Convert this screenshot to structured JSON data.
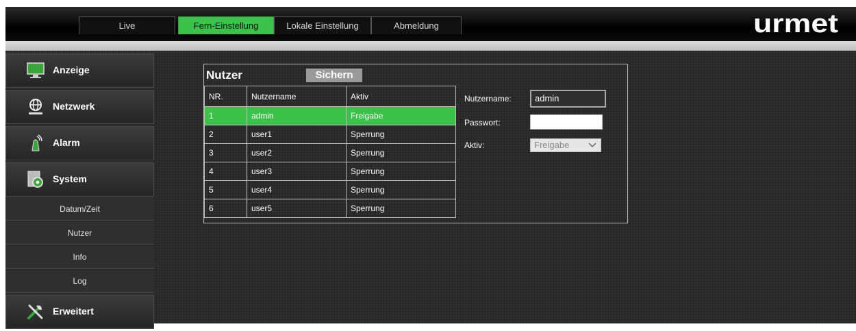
{
  "nav_tabs": [
    {
      "label": "Live",
      "active": false
    },
    {
      "label": "Fern-Einstellung",
      "active": true
    },
    {
      "label": "Lokale Einstellung",
      "active": false
    },
    {
      "label": "Abmeldung",
      "active": false
    }
  ],
  "logo_text": "urmet",
  "sidebar": {
    "items": [
      {
        "label": "Anzeige",
        "icon": "monitor-icon"
      },
      {
        "label": "Netzwerk",
        "icon": "network-globe-icon"
      },
      {
        "label": "Alarm",
        "icon": "alarm-siren-icon"
      },
      {
        "label": "System",
        "icon": "system-gear-icon"
      }
    ],
    "system_subitems": [
      {
        "label": "Datum/Zeit"
      },
      {
        "label": "Nutzer"
      },
      {
        "label": "Info"
      },
      {
        "label": "Log"
      }
    ],
    "advanced": {
      "label": "Erweitert",
      "icon": "tools-icon"
    }
  },
  "panel": {
    "title": "Nutzer",
    "save_label": "Sichern"
  },
  "table": {
    "headers": [
      "NR.",
      "Nutzername",
      "Aktiv"
    ],
    "rows": [
      {
        "nr": "1",
        "name": "admin",
        "status": "Freigabe",
        "selected": true
      },
      {
        "nr": "2",
        "name": "user1",
        "status": "Sperrung",
        "selected": false
      },
      {
        "nr": "3",
        "name": "user2",
        "status": "Sperrung",
        "selected": false
      },
      {
        "nr": "4",
        "name": "user3",
        "status": "Sperrung",
        "selected": false
      },
      {
        "nr": "5",
        "name": "user4",
        "status": "Sperrung",
        "selected": false
      },
      {
        "nr": "6",
        "name": "user5",
        "status": "Sperrung",
        "selected": false
      }
    ]
  },
  "form": {
    "username_label": "Nutzername:",
    "username_value": "admin",
    "password_label": "Passwort:",
    "password_value": "",
    "active_label": "Aktiv:",
    "active_value": "Freigabe"
  },
  "colors": {
    "accent": "#3cc14a",
    "background": "#2f2f2f"
  }
}
